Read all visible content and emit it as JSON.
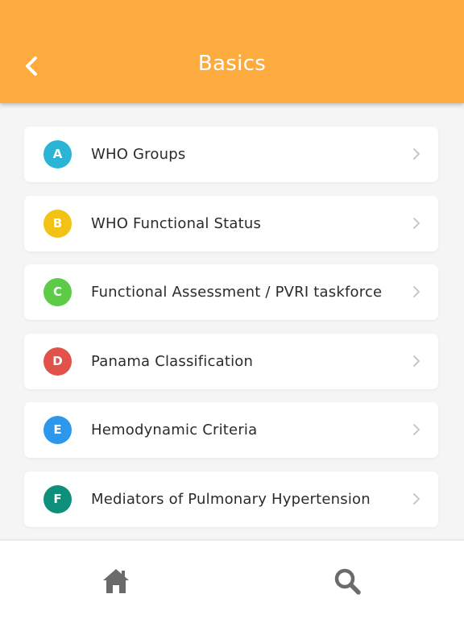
{
  "header": {
    "title": "Basics",
    "back_icon": "chevron-left-icon",
    "background_color": "#fdab3e"
  },
  "items": [
    {
      "letter": "A",
      "label": "WHO Groups",
      "color": "#2ab4d6"
    },
    {
      "letter": "B",
      "label": "WHO Functional Status",
      "color": "#f2c314"
    },
    {
      "letter": "C",
      "label": "Functional Assessment / PVRI taskforce",
      "color": "#5dcb47"
    },
    {
      "letter": "D",
      "label": "Panama Classification",
      "color": "#e0524a"
    },
    {
      "letter": "E",
      "label": "Hemodynamic Criteria",
      "color": "#2d97ec"
    },
    {
      "letter": "F",
      "label": "Mediators of Pulmonary Hypertension",
      "color": "#0d8f7c"
    }
  ],
  "bottom_nav": {
    "home_icon": "home-icon",
    "search_icon": "search-icon",
    "icon_color": "#6b6b6b"
  }
}
